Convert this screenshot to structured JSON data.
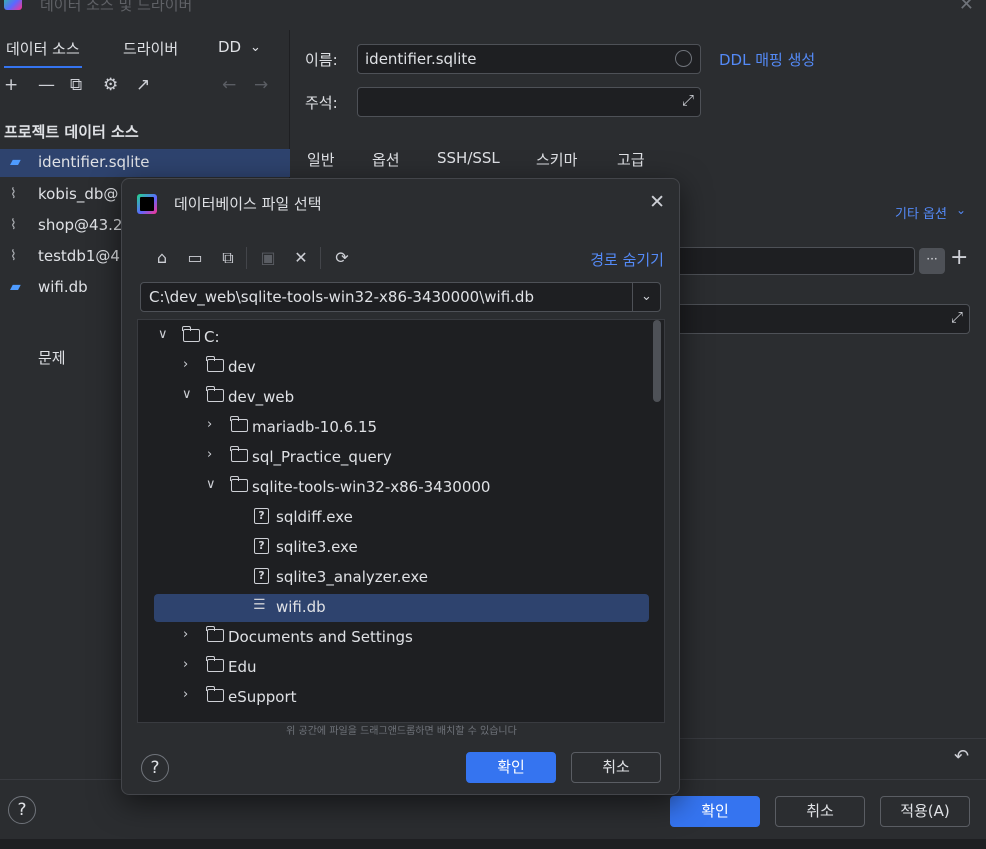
{
  "window": {
    "title": "데이터 소스 및 드라이버"
  },
  "left_panel": {
    "tabs": [
      "데이터 소스",
      "드라이버",
      "DD"
    ],
    "toolbar": {
      "add": "+",
      "remove": "—",
      "copy": "⧉",
      "settings": "⚙",
      "open": "↗",
      "back": "←",
      "forward": "→"
    },
    "section_title": "프로젝트 데이터 소스",
    "items": [
      {
        "label": "identifier.sqlite",
        "icon": "sqlite-icon"
      },
      {
        "label": "kobis_db@",
        "icon": "mysql-icon"
      },
      {
        "label": "shop@43.2",
        "icon": "mysql-icon"
      },
      {
        "label": "testdb1@4",
        "icon": "mysql-icon"
      },
      {
        "label": "wifi.db",
        "icon": "sqlite-icon"
      }
    ],
    "problems": "문제"
  },
  "right_panel": {
    "name_label": "이름:",
    "name_value": "identifier.sqlite",
    "ddl_link": "DDL 매핑 생성",
    "comment_label": "주석:",
    "tabs": [
      "일반",
      "옵션",
      "SSH/SSL",
      "스키마",
      "고급"
    ],
    "other_options": "기타 옵션"
  },
  "footer": {
    "ok": "확인",
    "cancel": "취소",
    "apply": "적용(A)",
    "help": "?"
  },
  "modal": {
    "title": "데이터베이스 파일 선택",
    "hide_path": "경로 숨기기",
    "path_value": "C:\\dev_web\\sqlite-tools-win32-x86-3430000\\wifi.db",
    "tree": [
      {
        "label": "C:",
        "type": "folder",
        "expanded": true
      },
      {
        "label": "dev",
        "type": "folder",
        "expanded": false
      },
      {
        "label": "dev_web",
        "type": "folder",
        "expanded": true
      },
      {
        "label": "mariadb-10.6.15",
        "type": "folder",
        "expanded": false
      },
      {
        "label": "sql_Practice_query",
        "type": "folder",
        "expanded": false
      },
      {
        "label": "sqlite-tools-win32-x86-3430000",
        "type": "folder",
        "expanded": true
      },
      {
        "label": "sqldiff.exe",
        "type": "file-unknown"
      },
      {
        "label": "sqlite3.exe",
        "type": "file-unknown"
      },
      {
        "label": "sqlite3_analyzer.exe",
        "type": "file-unknown"
      },
      {
        "label": "wifi.db",
        "type": "database",
        "selected": true
      },
      {
        "label": "Documents and Settings",
        "type": "folder",
        "expanded": false
      },
      {
        "label": "Edu",
        "type": "folder",
        "expanded": false
      },
      {
        "label": "eSupport",
        "type": "folder",
        "expanded": false
      }
    ],
    "drop_hint": "위 공간에 파일을 드래그앤드롭하면 배치할 수 있습니다",
    "ok": "확인",
    "cancel": "취소",
    "help": "?"
  }
}
